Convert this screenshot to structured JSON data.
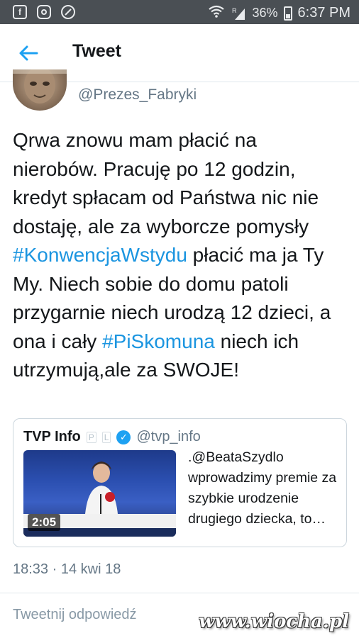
{
  "status_bar": {
    "battery": "36%",
    "time": "6:37 PM",
    "signal_tag": "R",
    "left_icons": [
      "facebook-icon",
      "instagram-icon",
      "shield-icon"
    ]
  },
  "header": {
    "title": "Tweet",
    "back_icon": "arrow-left-icon"
  },
  "tweet": {
    "handle": "@Prezes_Fabryki",
    "text_parts": {
      "p1": "Qrwa znowu mam płacić na nierobów. Pracuję po 12 godzin, kredyt spłacam od Państwa nic nie dostaję, ale za wyborcze pomysły ",
      "tag1": "#KonwencjaWstydu",
      "p2": " płacić ma ja Ty My. Niech sobie do domu patoli przygarnie niech urodzą 12 dzieci, a ona i cały ",
      "tag2": "#PiSkomuna",
      "p3": " niech ich utrzymują,ale za SWOJE!"
    },
    "timestamp": "18:33 · 14 kwi 18"
  },
  "quoted": {
    "name": "TVP Info",
    "badge1": "P",
    "badge2": "L",
    "handle": "@tvp_info",
    "text": ".@BeataSzydlo wprowadzimy premie za szybkie urodzenie drugiego dziecka, to…",
    "duration": "2:05"
  },
  "reply": {
    "placeholder": "Tweetnij odpowiedź"
  },
  "watermark": "www.wiocha.pl",
  "colors": {
    "accent": "#1da1f2",
    "hashtag": "#1b95e0",
    "status_bar": "#4a4f54",
    "secondary_text": "#657786"
  }
}
